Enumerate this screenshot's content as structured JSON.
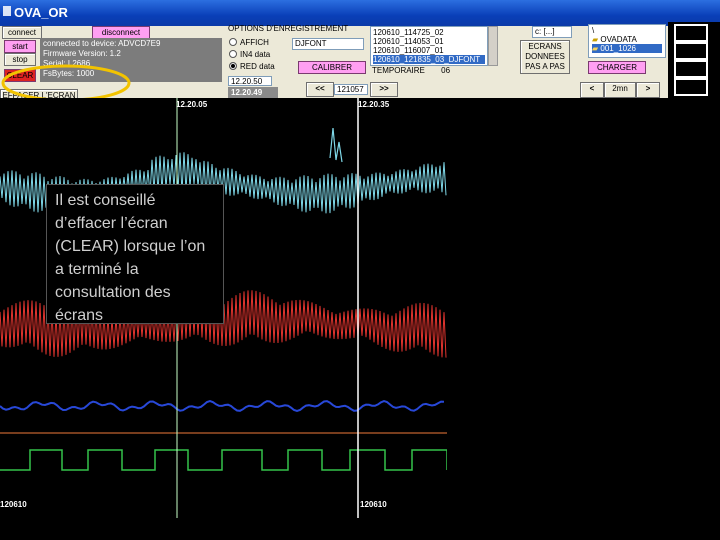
{
  "window": {
    "title": "OVA_OR"
  },
  "controls": {
    "connect": "connect",
    "disconnect": "disconnect",
    "start": "start",
    "stop": "stop",
    "clear": "CLEAR",
    "effacer": "EFFACER L'ECRAN"
  },
  "device": {
    "lines": [
      "connected to device: ADVCD7E9",
      "Firmware Version: 1.2",
      "Serial: L2686",
      "FsBytes: 1000"
    ]
  },
  "options": {
    "heading": "OPTIONS D'ENREGISTREMENT",
    "radios": [
      {
        "label": "AFFICH",
        "selected": false
      },
      {
        "label": "IN4 data",
        "selected": false
      },
      {
        "label": "RED data",
        "selected": true
      }
    ],
    "field_value": "DJFONT",
    "calibrer": "CALIBRER",
    "time_a": "12.20.50",
    "time_b": "12.20.49",
    "prev": "<<",
    "next": ">>",
    "time_field": "121057"
  },
  "files": {
    "items": [
      "120610_114725_02",
      "120610_114053_01",
      "120610_116007_01",
      "120610_121835_03_DJFONT"
    ],
    "selected_index": 3,
    "temp_label": "TEMPORAIRE",
    "temp_value": "06"
  },
  "screens": {
    "label": "ECRANS DONNEES PAS A PAS",
    "drive": "c: [...]",
    "folders": [
      "\\",
      "OVADATA",
      "001_1026"
    ],
    "selected_folder": 2,
    "charger": "CHARGER",
    "prev": "<",
    "next": ">",
    "value": "2mn"
  },
  "plot": {
    "time_left": "12.20.05",
    "time_right": "12.20.35",
    "date_left": "120610",
    "date_right": "120610"
  },
  "callout": {
    "text": "Il est conseillé d’effacer l’écran (CLEAR) lorsque l’on a terminé la consultation des écrans"
  },
  "colors": {
    "trace1": "#7fd8e8",
    "trace2": "#e0342e",
    "trace3": "#2848d8",
    "trace4": "#f07a3a",
    "trace5": "#34c24a",
    "cursor": "#c8ffc8",
    "highlight": "#f2c300"
  }
}
